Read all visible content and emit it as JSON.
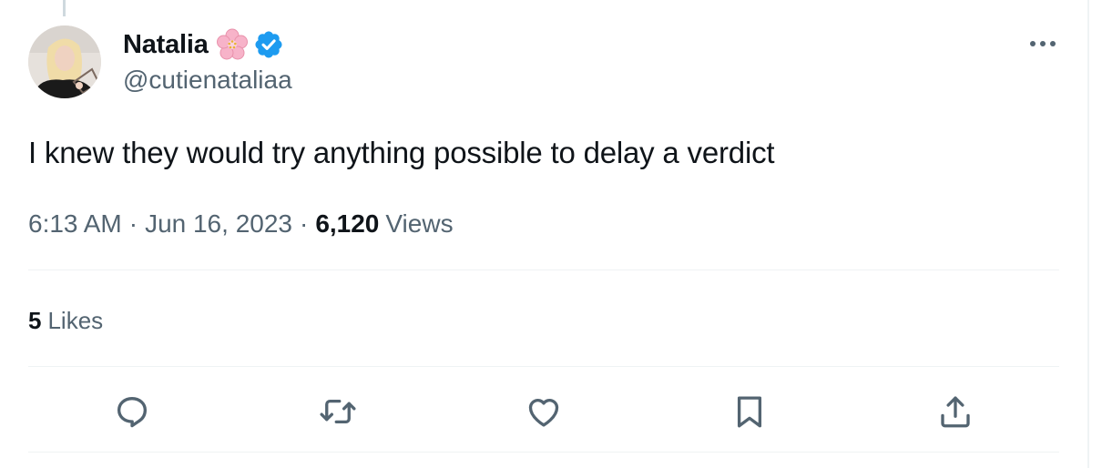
{
  "author": {
    "display_name": "Natalia",
    "handle": "@cutienataliaa",
    "verified": true,
    "name_emoji": "cherry-blossom-icon"
  },
  "tweet": {
    "text": "I knew they would try anything possible to delay a verdict",
    "time": "6:13 AM",
    "date": "Jun 16, 2023",
    "separator": "·",
    "views_count": "6,120",
    "views_label": "Views",
    "likes_count": "5",
    "likes_label": "Likes"
  },
  "actions": [
    "reply-icon",
    "retweet-icon",
    "like-icon",
    "bookmark-icon",
    "share-icon"
  ],
  "colors": {
    "text": "#0f1419",
    "secondary": "#536471",
    "divider": "#eff3f4",
    "verified": "#1d9bf0"
  }
}
